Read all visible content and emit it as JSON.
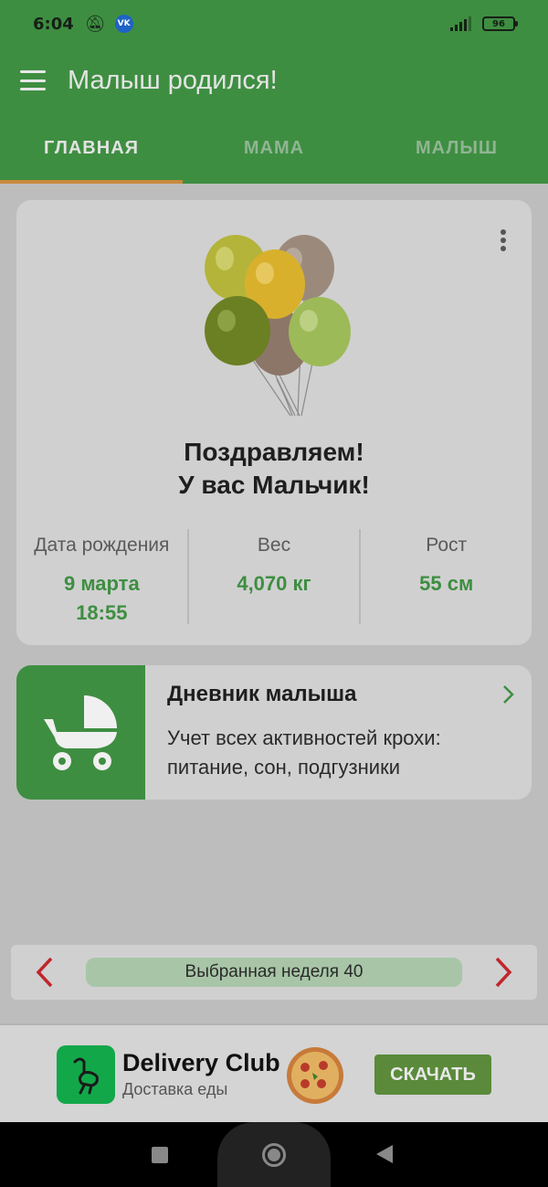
{
  "status_bar": {
    "time": "6:04",
    "vk": "VK",
    "battery": "96"
  },
  "app_bar": {
    "title": "Малыш родился!"
  },
  "tabs": [
    {
      "label": "ГЛАВНАЯ",
      "active": true
    },
    {
      "label": "МАМА",
      "active": false
    },
    {
      "label": "МАЛЫШ",
      "active": false
    }
  ],
  "congrats_card": {
    "line1": "Поздравляем!",
    "line2": "У вас Мальчик!",
    "stats": [
      {
        "label": "Дата рождения",
        "value_line1": "9 марта",
        "value_line2": "18:55"
      },
      {
        "label": "Вес",
        "value_line1": "4,070 кг",
        "value_line2": ""
      },
      {
        "label": "Рост",
        "value_line1": "55 см",
        "value_line2": ""
      }
    ]
  },
  "diary_card": {
    "title": "Дневник малыша",
    "description": "Учет всех активностей крохи: питание, сон, подгузники"
  },
  "week_selector": {
    "label": "Выбранная неделя 40"
  },
  "ad": {
    "title": "Delivery Club",
    "subtitle": "Доставка еды",
    "cta": "СКАЧАТЬ"
  },
  "colors": {
    "primary_green": "#3e8e41",
    "tab_indicator": "#c98a3c",
    "arrow_red": "#c0262c"
  }
}
